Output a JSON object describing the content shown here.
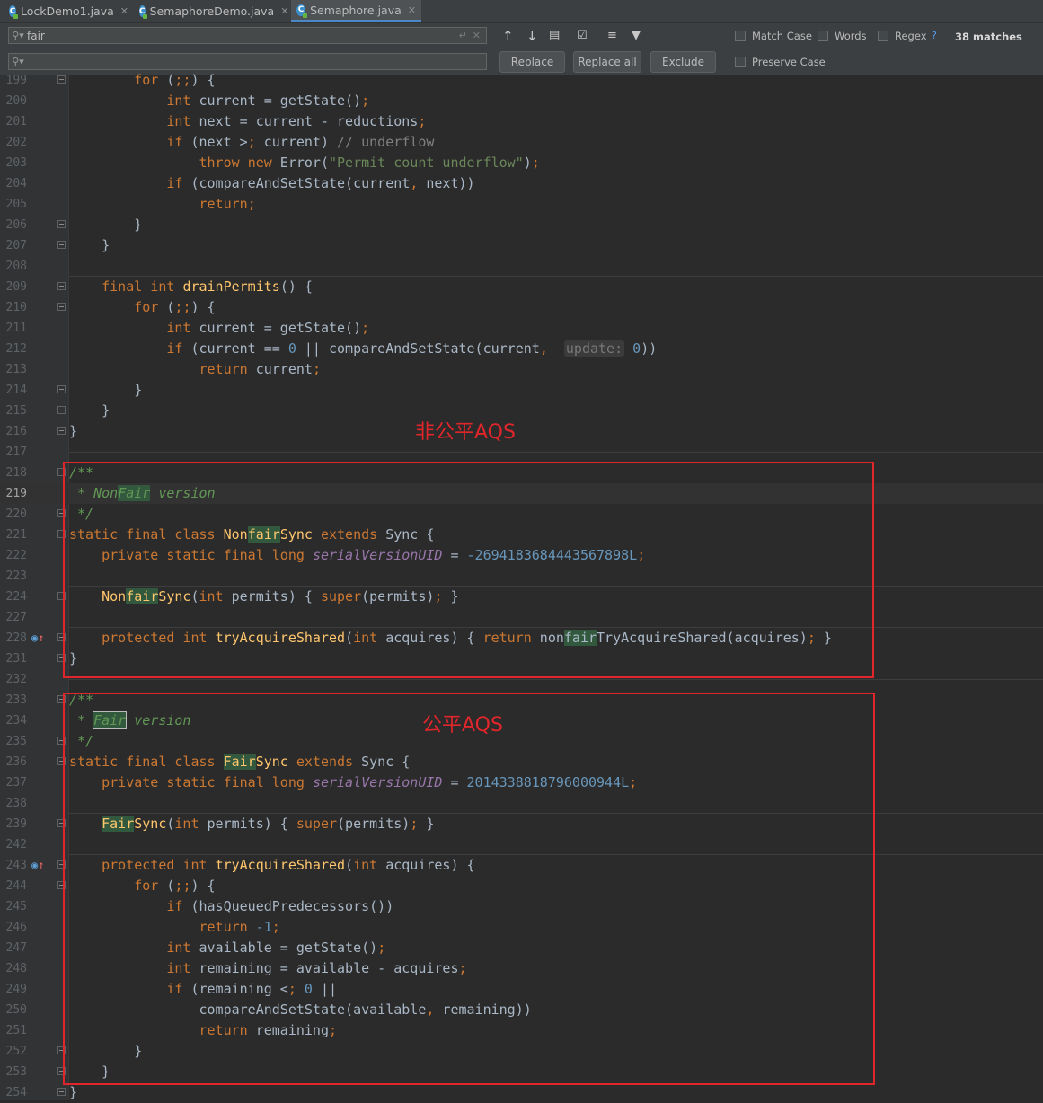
{
  "tabs": [
    {
      "label": "LockDemo1.java"
    },
    {
      "label": "SemaphoreDemo.java"
    },
    {
      "label": "Semaphore.java"
    }
  ],
  "find": {
    "search_value": "fair",
    "replace_value": "",
    "match_count": "38 matches",
    "options": {
      "match_case": "Match Case",
      "words": "Words",
      "regex": "Regex",
      "regex_help": "?",
      "preserve_case": "Preserve Case"
    },
    "buttons": {
      "replace": "Replace",
      "replace_all": "Replace all",
      "exclude": "Exclude"
    }
  },
  "editor": {
    "current_line": "219",
    "lines": [
      {
        "no": "199",
        "text": "        for (;;) {"
      },
      {
        "no": "200",
        "text": "            int current = getState();"
      },
      {
        "no": "201",
        "text": "            int next = current - reductions;"
      },
      {
        "no": "202",
        "text": "            if (next > current) // underflow"
      },
      {
        "no": "203",
        "text": "                throw new Error(\"Permit count underflow\");"
      },
      {
        "no": "204",
        "text": "            if (compareAndSetState(current, next))"
      },
      {
        "no": "205",
        "text": "                return;"
      },
      {
        "no": "206",
        "text": "        }"
      },
      {
        "no": "207",
        "text": "    }"
      },
      {
        "no": "208",
        "text": ""
      },
      {
        "no": "209",
        "text": "    final int drainPermits() {"
      },
      {
        "no": "210",
        "text": "        for (;;) {"
      },
      {
        "no": "211",
        "text": "            int current = getState();"
      },
      {
        "no": "212",
        "text": "            if (current == 0 || compareAndSetState(current,  update: 0))"
      },
      {
        "no": "213",
        "text": "                return current;"
      },
      {
        "no": "214",
        "text": "        }"
      },
      {
        "no": "215",
        "text": "    }"
      },
      {
        "no": "216",
        "text": "}"
      },
      {
        "no": "217",
        "text": ""
      },
      {
        "no": "218",
        "text": "/**"
      },
      {
        "no": "219",
        "text": " * NonFair version"
      },
      {
        "no": "220",
        "text": " */"
      },
      {
        "no": "221",
        "text": "static final class NonfairSync extends Sync {"
      },
      {
        "no": "222",
        "text": "    private static final long serialVersionUID = -2694183684443567898L;"
      },
      {
        "no": "223",
        "text": ""
      },
      {
        "no": "224",
        "text": "    NonfairSync(int permits) { super(permits); }"
      },
      {
        "no": "227",
        "text": ""
      },
      {
        "no": "228",
        "text": "    protected int tryAcquireShared(int acquires) { return nonfairTryAcquireShared(acquires); }"
      },
      {
        "no": "231",
        "text": "}"
      },
      {
        "no": "232",
        "text": ""
      },
      {
        "no": "233",
        "text": "/**"
      },
      {
        "no": "234",
        "text": " * Fair version"
      },
      {
        "no": "235",
        "text": " */"
      },
      {
        "no": "236",
        "text": "static final class FairSync extends Sync {"
      },
      {
        "no": "237",
        "text": "    private static final long serialVersionUID = 2014338818796000944L;"
      },
      {
        "no": "238",
        "text": ""
      },
      {
        "no": "239",
        "text": "    FairSync(int permits) { super(permits); }"
      },
      {
        "no": "242",
        "text": ""
      },
      {
        "no": "243",
        "text": "    protected int tryAcquireShared(int acquires) {"
      },
      {
        "no": "244",
        "text": "        for (;;) {"
      },
      {
        "no": "245",
        "text": "            if (hasQueuedPredecessors())"
      },
      {
        "no": "246",
        "text": "                return -1;"
      },
      {
        "no": "247",
        "text": "            int available = getState();"
      },
      {
        "no": "248",
        "text": "            int remaining = available - acquires;"
      },
      {
        "no": "249",
        "text": "            if (remaining < 0 ||"
      },
      {
        "no": "250",
        "text": "                compareAndSetState(available, remaining))"
      },
      {
        "no": "251",
        "text": "                return remaining;"
      },
      {
        "no": "252",
        "text": "        }"
      },
      {
        "no": "253",
        "text": "    }"
      },
      {
        "no": "254",
        "text": "}"
      }
    ]
  },
  "annotations": {
    "nonfair_label": "非公平AQS",
    "fair_label": "公平AQS",
    "color": "#e0262b"
  },
  "colors": {
    "background": "#2b2b2b",
    "keyword": "#cc7832",
    "function": "#ffc66d",
    "string": "#6a8759",
    "number": "#6897bb",
    "doc_comment": "#629755",
    "search_match": "#32593d",
    "tab_underline": "#4a88c7"
  },
  "icons": [
    "java-class-icon",
    "close-icon",
    "search-icon",
    "previous-occurrence-icon",
    "next-occurrence-icon",
    "filter-icon",
    "override-method-icon"
  ]
}
